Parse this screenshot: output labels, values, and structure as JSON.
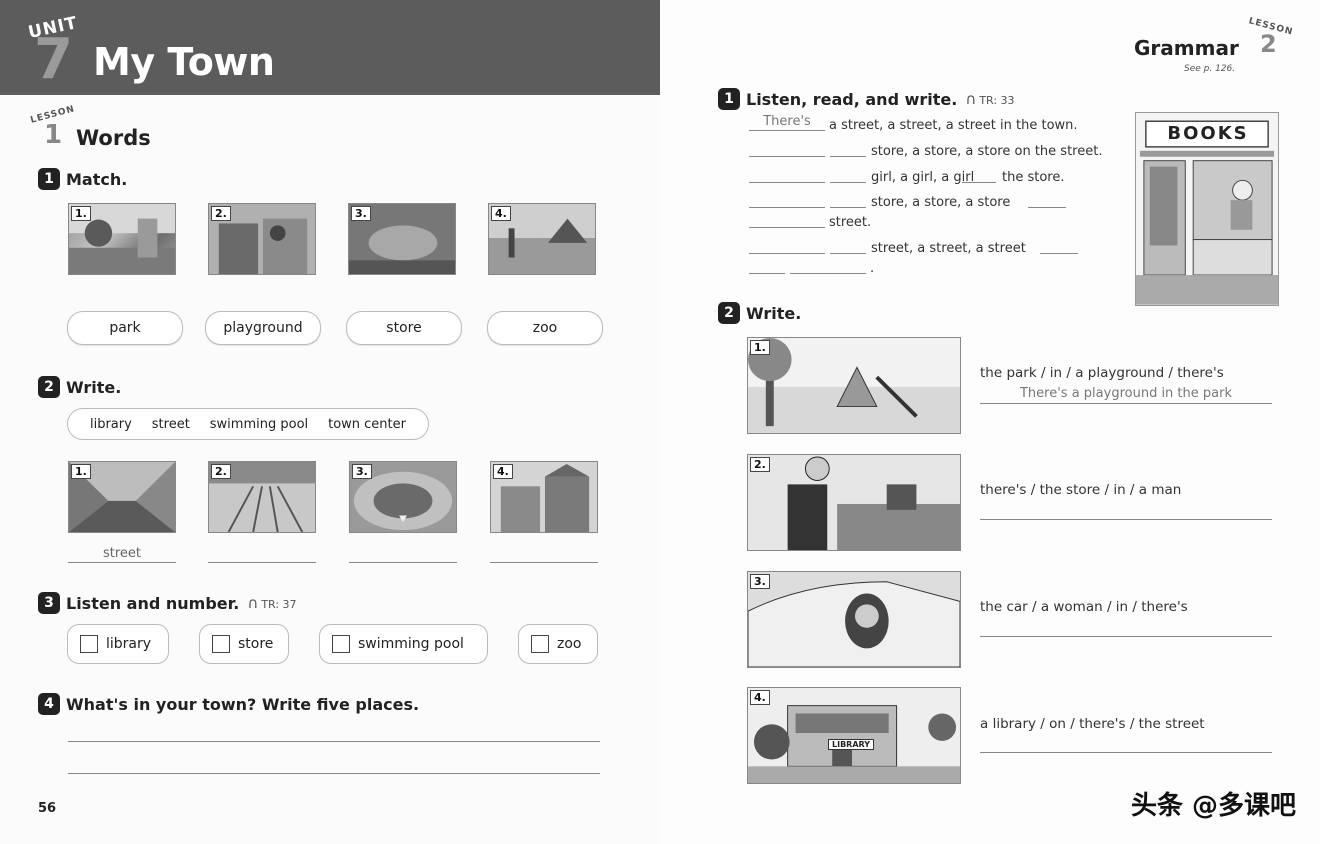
{
  "left": {
    "unit_label": "UNIT",
    "unit_number": "7",
    "unit_title": "My Town",
    "lesson_label": "LESSON",
    "lesson_number": "1",
    "section_title": "Words",
    "ex1": {
      "number": "1",
      "title": "Match.",
      "photos": [
        "1.",
        "2.",
        "3.",
        "4."
      ],
      "words": [
        "park",
        "playground",
        "store",
        "zoo"
      ]
    },
    "ex2": {
      "number": "2",
      "title": "Write.",
      "wordbank": [
        "library",
        "street",
        "swimming pool",
        "town center"
      ],
      "photos": [
        "1.",
        "2.",
        "3.",
        "4."
      ],
      "answers": [
        "street",
        "",
        "",
        ""
      ]
    },
    "ex3": {
      "number": "3",
      "title": "Listen and number.",
      "track": "TR: 37",
      "options": [
        "library",
        "store",
        "swimming pool",
        "zoo"
      ]
    },
    "ex4": {
      "number": "4",
      "title": "What's in your town? Write five places."
    },
    "page_number": "56"
  },
  "right": {
    "grammar_title": "Grammar",
    "lesson_label": "LESSON",
    "lesson_number": "2",
    "see_page": "See p. 126.",
    "ex1": {
      "number": "1",
      "title": "Listen, read, and write.",
      "track": "TR: 33",
      "first_answer": "There's",
      "fragments": [
        "a street, a street, a street in the town.",
        "store, a store, a store on the street.",
        "girl, a girl, a girl",
        "the store.",
        "store, a store, a store",
        "street.",
        "street, a street, a street"
      ],
      "books_sign": "BOOKS"
    },
    "ex2": {
      "number": "2",
      "title": "Write.",
      "items": [
        {
          "num": "1.",
          "prompt": "the park / in / a playground / there's",
          "answer": "There's a playground in the park"
        },
        {
          "num": "2.",
          "prompt": "there's / the store / in / a man",
          "answer": ""
        },
        {
          "num": "3.",
          "prompt": "the car / a woman / in / there's",
          "answer": ""
        },
        {
          "num": "4.",
          "prompt": "a library / on / there's / the street",
          "answer": ""
        }
      ],
      "library_sign": "LIBRARY"
    }
  },
  "watermark": "头条 @多课吧"
}
